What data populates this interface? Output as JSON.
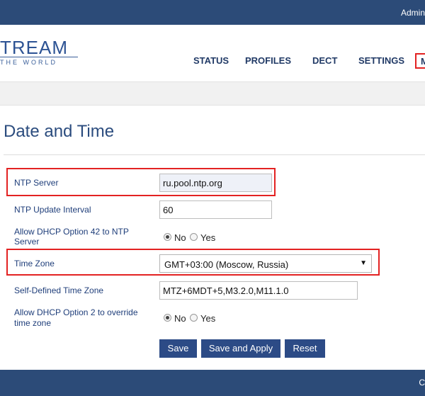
{
  "header": {
    "user_label": "Admin"
  },
  "logo": {
    "main": "TREAM",
    "sub": "THE WORLD"
  },
  "nav": [
    {
      "label": "STATUS"
    },
    {
      "label": "PROFILES"
    },
    {
      "label": "DECT"
    },
    {
      "label": "SETTINGS"
    },
    {
      "label": "M"
    }
  ],
  "page": {
    "title": "Date and Time"
  },
  "form": {
    "ntp_server": {
      "label": "NTP Server",
      "value": "ru.pool.ntp.org"
    },
    "ntp_interval": {
      "label": "NTP Update Interval",
      "value": "60"
    },
    "dhcp42": {
      "label_line1": "Allow DHCP Option 42 to NTP",
      "label_line2": "Server",
      "no": "No",
      "yes": "Yes",
      "selected": "No"
    },
    "time_zone": {
      "label": "Time Zone",
      "value": "GMT+03:00 (Moscow, Russia)"
    },
    "self_tz": {
      "label": "Self-Defined Time Zone",
      "value": "MTZ+6MDT+5,M3.2.0,M11.1.0"
    },
    "dhcp2": {
      "label_line1": "Allow DHCP Option 2 to override",
      "label_line2": "time zone",
      "no": "No",
      "yes": "Yes",
      "selected": "No"
    }
  },
  "buttons": {
    "save": "Save",
    "save_apply": "Save and Apply",
    "reset": "Reset"
  },
  "footer": {
    "text": "C"
  },
  "colors": {
    "header_bg": "#2c4b78",
    "button_bg": "#2c4b86",
    "highlight": "#e32222",
    "title": "#2b4c7e"
  }
}
